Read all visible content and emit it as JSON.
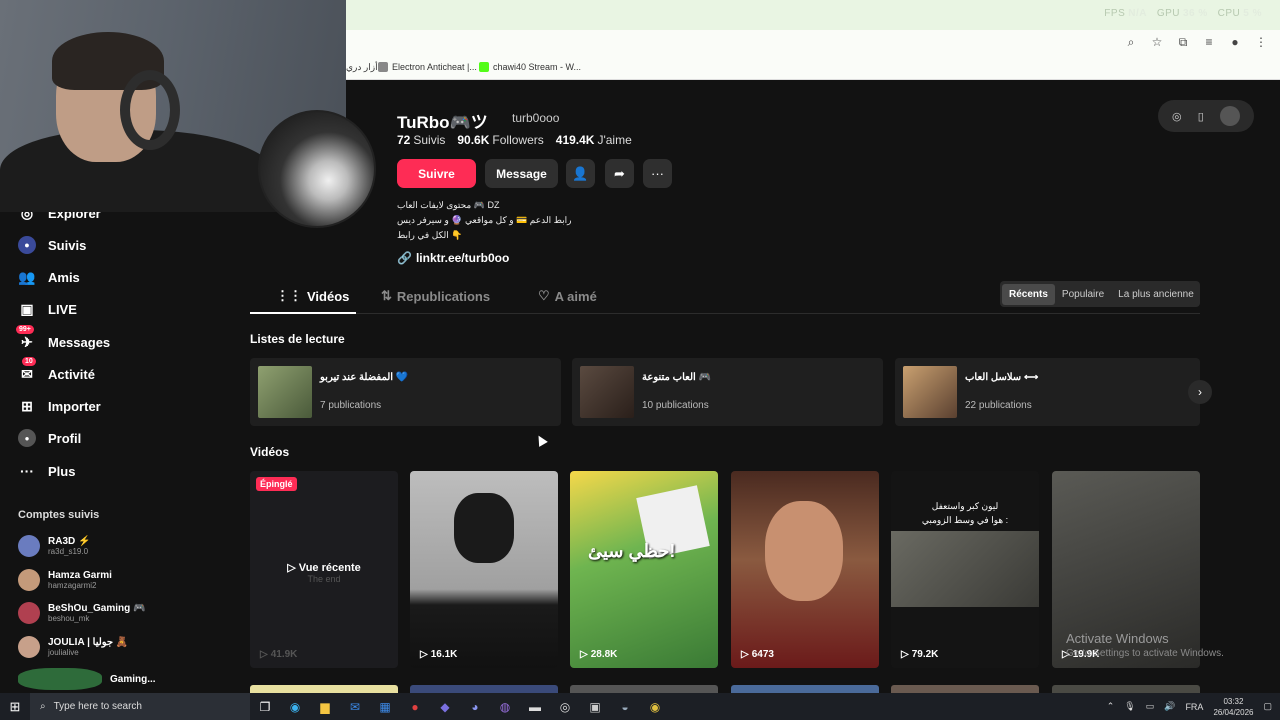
{
  "browser": {
    "perf": [
      {
        "label": "FPS",
        "value": "N/A"
      },
      {
        "label": "GPU",
        "value": "36 %"
      },
      {
        "label": "CPU",
        "value": "5 %"
      }
    ],
    "bookmarks": [
      {
        "label": "أزار دري",
        "icon": "bookmark-icon"
      },
      {
        "label": "Electron Anticheat |...",
        "icon": "gear-icon",
        "color": "#888888"
      },
      {
        "label": "chawi40 Stream - W...",
        "icon": "kick-icon",
        "color": "#53fc18"
      }
    ]
  },
  "sidebar": {
    "items": [
      {
        "label": "Explorer",
        "icon": "compass-icon"
      },
      {
        "label": "Suivis",
        "icon": "following-icon"
      },
      {
        "label": "Amis",
        "icon": "friends-icon"
      },
      {
        "label": "LIVE",
        "icon": "live-icon"
      },
      {
        "label": "Messages",
        "icon": "messages-icon",
        "badge": "99+"
      },
      {
        "label": "Activité",
        "icon": "activity-icon",
        "badge": "10"
      },
      {
        "label": "Importer",
        "icon": "upload-icon"
      },
      {
        "label": "Profil",
        "icon": "profile-icon"
      },
      {
        "label": "Plus",
        "icon": "more-icon"
      }
    ],
    "followed_title": "Comptes suivis",
    "followed": [
      {
        "name": "RA3D ⚡",
        "handle": "ra3d_s19.0",
        "color": "#6a7cbf"
      },
      {
        "name": "Hamza Garmi",
        "handle": "hamzagarmi2",
        "color": "#c49a7a"
      },
      {
        "name": "BeShOu_Gaming 🎮",
        "handle": "beshou_mk",
        "color": "#b04050"
      },
      {
        "name": "JOULIA | جوليا 🧸",
        "handle": "joulialive",
        "color": "#c7a08a"
      },
      {
        "name": "Gaming...",
        "handle": "",
        "color": "#2e6b3a"
      }
    ]
  },
  "profile": {
    "username": "TuRbo🎮ツ",
    "handle": "turb0ooo",
    "following_count": "72",
    "following_label": "Suivis",
    "followers_count": "90.6K",
    "followers_label": "Followers",
    "likes_count": "419.4K",
    "likes_label": "J'aime",
    "follow_label": "Suivre",
    "message_label": "Message",
    "bio": [
      "محتوى لايفات العاب 🎮 DZ",
      "رابط الدعم 💳 و كل مواقعي 🔮 و سيرفر ديس",
      "الكل في رابط 👇"
    ],
    "link": "linktr.ee/turb0oo"
  },
  "tabs": [
    {
      "label": "Vidéos",
      "icon": "grid-icon"
    },
    {
      "label": "Republications",
      "icon": "repost-icon"
    },
    {
      "label": "A aimé",
      "icon": "heart-icon"
    }
  ],
  "sort": [
    "Récents",
    "Populaire",
    "La plus ancienne"
  ],
  "playlists_title": "Listes de lecture",
  "playlists": [
    {
      "title": "المفضلة عند تيربو 💙",
      "count": "7 publications",
      "color": "#6b7a5a"
    },
    {
      "title": "العاب متنوعة 🎮",
      "count": "10 publications",
      "color": "#4a3a32"
    },
    {
      "title": "سلاسل العاب ⟷",
      "count": "22 publications",
      "color": "#8a6a4a"
    }
  ],
  "videos_title": "Vidéos",
  "videos": [
    {
      "views": "41.9K",
      "pinned": "Épinglé",
      "overlay": "Vue récente",
      "caption": "The end",
      "color": "#1c1c1f"
    },
    {
      "views": "16.1K",
      "color": "#bdbdbd"
    },
    {
      "views": "28.8K",
      "caption": "حظي سيئ!",
      "color": "#5aa24a"
    },
    {
      "views": "6473",
      "color": "#6b3a2a"
    },
    {
      "views": "79.2K",
      "caption": "ليون كبر واستعفل\nهوا في وسط الزومبي :",
      "color": "#1a1a1a"
    },
    {
      "views": "19.9K",
      "color": "#3a3a38"
    }
  ],
  "windows": {
    "activate_title": "Activate Windows",
    "activate_sub": "Go to Settings to activate Windows.",
    "search_placeholder": "Type here to search",
    "lang": "FRA",
    "time": "03:32",
    "date": "26/04/2026"
  }
}
